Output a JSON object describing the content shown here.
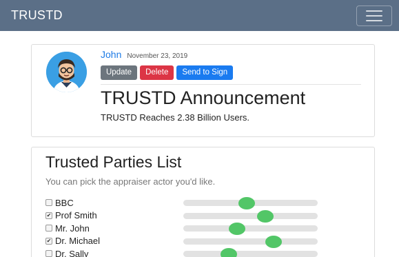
{
  "navbar": {
    "brand": "TRUSTD"
  },
  "post": {
    "author": "John",
    "date": "November 23, 2019",
    "buttons": {
      "update": "Update",
      "delete": "Delete",
      "sign": "Send to Sign"
    },
    "title": "TRUSTD Announcement",
    "body": "TRUSTD Reaches 2.38 Billion Users."
  },
  "parties": {
    "title": "Trusted Parties List",
    "hint": "You can pick the appraiser actor you'd like.",
    "items": [
      {
        "name": "BBC",
        "checked": false,
        "level": 0.47
      },
      {
        "name": "Prof Smith",
        "checked": true,
        "level": 0.61
      },
      {
        "name": "Mr. John",
        "checked": false,
        "level": 0.4
      },
      {
        "name": "Dr. Michael",
        "checked": true,
        "level": 0.67
      },
      {
        "name": "Dr. Sally",
        "checked": false,
        "level": 0.34
      }
    ]
  },
  "colors": {
    "navbar": "#5b6f87",
    "author": "#1e7be6",
    "slider_thumb": "#52c667"
  }
}
